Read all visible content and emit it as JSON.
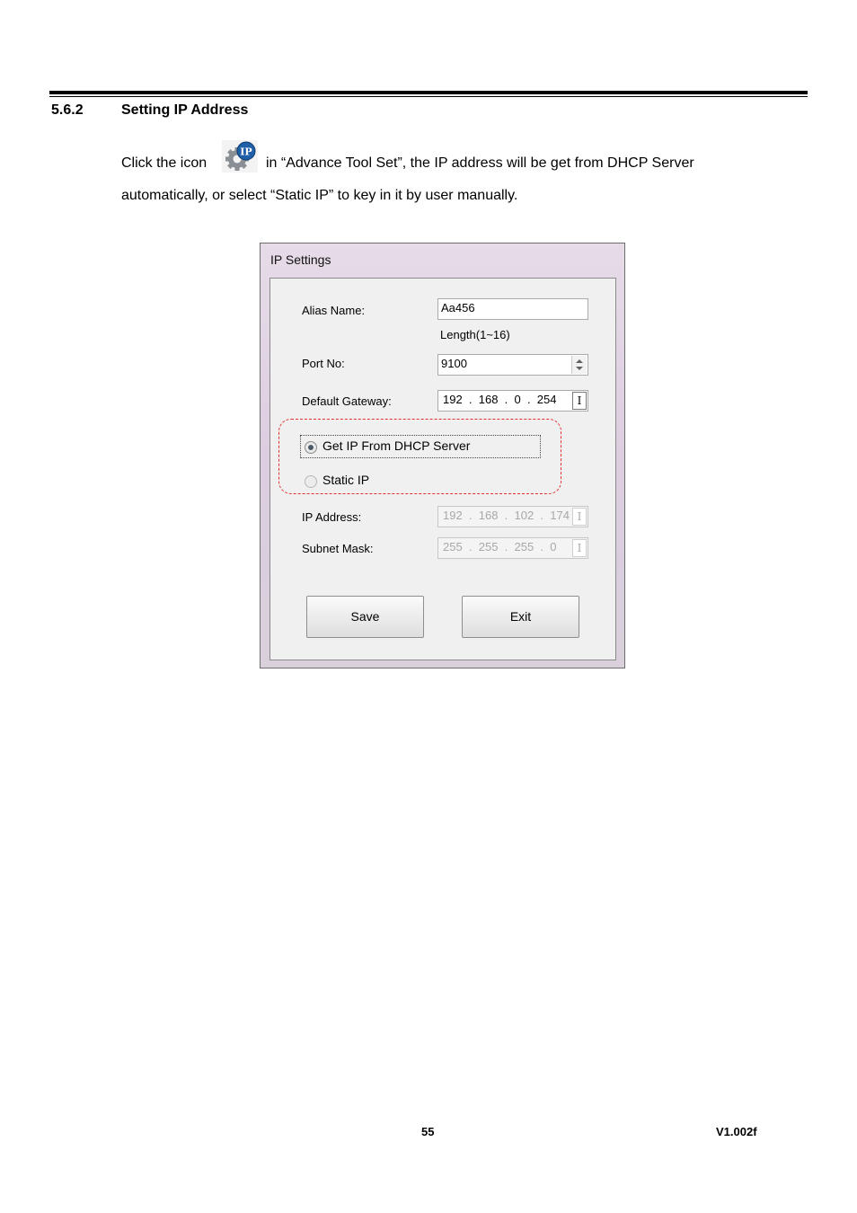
{
  "section": {
    "number": "5.6.2",
    "title": "Setting IP Address"
  },
  "paragraph": {
    "line1_before_icon": "Click the icon",
    "line1_after_icon": "in “Advance Tool Set”, the IP address will be get from DHCP Server",
    "line2": "automatically, or select “Static IP” to key in it by user manually.",
    "icon": "ip-settings-gear-icon"
  },
  "dialog": {
    "title": "IP Settings",
    "alias_label": "Alias Name:",
    "alias_value": "Aa456",
    "length_hint": "Length(1~16)",
    "port_label": "Port No:",
    "port_value": "9100",
    "gateway_label": "Default Gateway:",
    "gateway_value": "192  .  168  .  0  .  254",
    "dhcp_option": "Get IP From DHCP Server",
    "static_option": "Static IP",
    "selected_option": "Get IP From DHCP Server",
    "ip_label": "IP Address:",
    "ip_value": "192  .  168  .  102  .  174",
    "mask_label": "Subnet Mask:",
    "mask_value": "255  .  255  .  255  .  0",
    "save_button": "Save",
    "exit_button": "Exit",
    "highlight_color": "#e03030"
  },
  "footer": {
    "page_number": "55",
    "version": "V1.002f"
  }
}
